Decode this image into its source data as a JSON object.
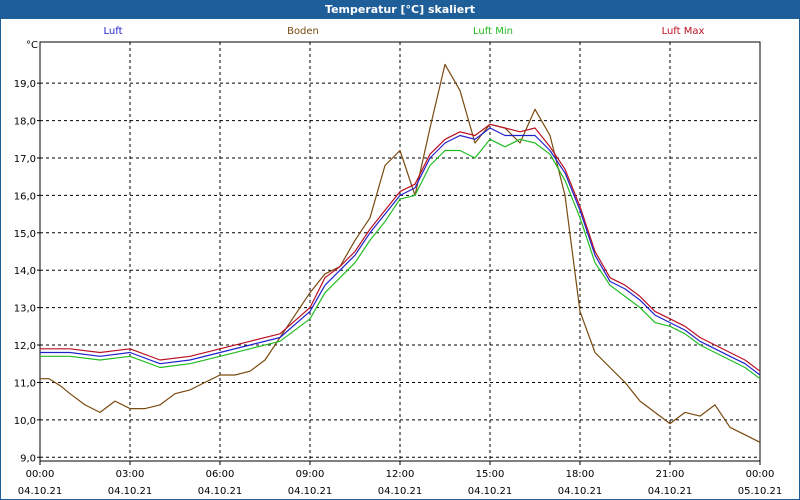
{
  "window": {
    "title": "Temperatur [°C] skaliert"
  },
  "chart_data": {
    "type": "line",
    "title": "Temperatur [°C] skaliert",
    "ylabel": "°C",
    "xlabel": "",
    "ylim": [
      8.9,
      20.1
    ],
    "xlim": [
      0,
      24
    ],
    "grid": true,
    "legend_placement": "top",
    "y_ticks": [
      "9,0",
      "10,0",
      "11,0",
      "12,0",
      "13,0",
      "14,0",
      "15,0",
      "16,0",
      "17,0",
      "18,0",
      "19,0"
    ],
    "x_ticks": [
      {
        "time": "00:00",
        "date": "04.10.21"
      },
      {
        "time": "03:00",
        "date": "04.10.21"
      },
      {
        "time": "06:00",
        "date": "04.10.21"
      },
      {
        "time": "09:00",
        "date": "04.10.21"
      },
      {
        "time": "12:00",
        "date": "04.10.21"
      },
      {
        "time": "15:00",
        "date": "04.10.21"
      },
      {
        "time": "18:00",
        "date": "04.10.21"
      },
      {
        "time": "21:00",
        "date": "04.10.21"
      },
      {
        "time": "00:00",
        "date": "05.10.21"
      }
    ],
    "series": [
      {
        "name": "Luft",
        "color": "#2222cc",
        "x": [
          0,
          1,
          2,
          3,
          4,
          5,
          6,
          7,
          8,
          9,
          9.5,
          10,
          10.5,
          11,
          11.5,
          12,
          12.5,
          13,
          13.5,
          14,
          14.5,
          15,
          15.5,
          16,
          16.5,
          17,
          17.5,
          18,
          18.5,
          19,
          19.5,
          20,
          20.5,
          21,
          21.5,
          22,
          22.5,
          23,
          23.5,
          24
        ],
        "values": [
          11.8,
          11.8,
          11.7,
          11.8,
          11.5,
          11.6,
          11.8,
          12.0,
          12.2,
          12.9,
          13.6,
          14.0,
          14.4,
          15.0,
          15.5,
          16.0,
          16.2,
          17.0,
          17.4,
          17.6,
          17.5,
          17.8,
          17.6,
          17.6,
          17.6,
          17.2,
          16.6,
          15.6,
          14.4,
          13.7,
          13.5,
          13.2,
          12.8,
          12.6,
          12.4,
          12.1,
          11.9,
          11.7,
          11.5,
          11.2
        ]
      },
      {
        "name": "Boden",
        "color": "#7a4a10",
        "x": [
          0,
          0.3,
          0.7,
          1,
          1.5,
          2,
          2.5,
          3,
          3.5,
          4,
          4.5,
          5,
          5.5,
          6,
          6.5,
          7,
          7.5,
          8,
          8.5,
          9,
          9.5,
          10,
          10.5,
          11,
          11.5,
          12,
          12.5,
          13,
          13.5,
          14,
          14.5,
          15,
          15.5,
          16,
          16.5,
          17,
          17.5,
          18,
          18.5,
          19,
          19.5,
          20,
          20.5,
          21,
          21.5,
          22,
          22.5,
          23,
          23.5,
          24
        ],
        "values": [
          11.1,
          11.1,
          10.9,
          10.7,
          10.4,
          10.2,
          10.5,
          10.3,
          10.3,
          10.4,
          10.7,
          10.8,
          11.0,
          11.2,
          11.2,
          11.3,
          11.6,
          12.2,
          12.8,
          13.4,
          13.9,
          14.1,
          14.8,
          15.4,
          16.8,
          17.2,
          16.0,
          17.8,
          19.5,
          18.8,
          17.4,
          17.9,
          17.8,
          17.4,
          18.3,
          17.6,
          16.0,
          12.9,
          11.8,
          11.4,
          11.0,
          10.5,
          10.2,
          9.9,
          10.2,
          10.1,
          10.4,
          9.8,
          9.6,
          9.4
        ]
      },
      {
        "name": "Luft Min",
        "color": "#22bb22",
        "x": [
          0,
          1,
          2,
          3,
          4,
          5,
          6,
          7,
          8,
          9,
          9.5,
          10,
          10.5,
          11,
          11.5,
          12,
          12.5,
          13,
          13.5,
          14,
          14.5,
          15,
          15.5,
          16,
          16.5,
          17,
          17.5,
          18,
          18.5,
          19,
          19.5,
          20,
          20.5,
          21,
          21.5,
          22,
          22.5,
          23,
          23.5,
          24
        ],
        "values": [
          11.7,
          11.7,
          11.6,
          11.7,
          11.4,
          11.5,
          11.7,
          11.9,
          12.1,
          12.7,
          13.4,
          13.8,
          14.2,
          14.8,
          15.3,
          15.9,
          16.0,
          16.8,
          17.2,
          17.2,
          17.0,
          17.5,
          17.3,
          17.5,
          17.4,
          17.1,
          16.4,
          15.4,
          14.2,
          13.6,
          13.3,
          13.0,
          12.6,
          12.5,
          12.3,
          12.0,
          11.8,
          11.6,
          11.4,
          11.1
        ]
      },
      {
        "name": "Luft Max",
        "color": "#bb1122",
        "x": [
          0,
          1,
          2,
          3,
          4,
          5,
          6,
          7,
          8,
          9,
          9.5,
          10,
          10.5,
          11,
          11.5,
          12,
          12.5,
          13,
          13.5,
          14,
          14.5,
          15,
          15.5,
          16,
          16.5,
          17,
          17.5,
          18,
          18.5,
          19,
          19.5,
          20,
          20.5,
          21,
          21.5,
          22,
          22.5,
          23,
          23.5,
          24
        ],
        "values": [
          11.9,
          11.9,
          11.8,
          11.9,
          11.6,
          11.7,
          11.9,
          12.1,
          12.3,
          13.0,
          13.8,
          14.1,
          14.5,
          15.1,
          15.6,
          16.1,
          16.3,
          17.1,
          17.5,
          17.7,
          17.6,
          17.9,
          17.8,
          17.7,
          17.8,
          17.3,
          16.7,
          15.7,
          14.5,
          13.8,
          13.6,
          13.3,
          12.9,
          12.7,
          12.5,
          12.2,
          12.0,
          11.8,
          11.6,
          11.3
        ]
      }
    ]
  }
}
